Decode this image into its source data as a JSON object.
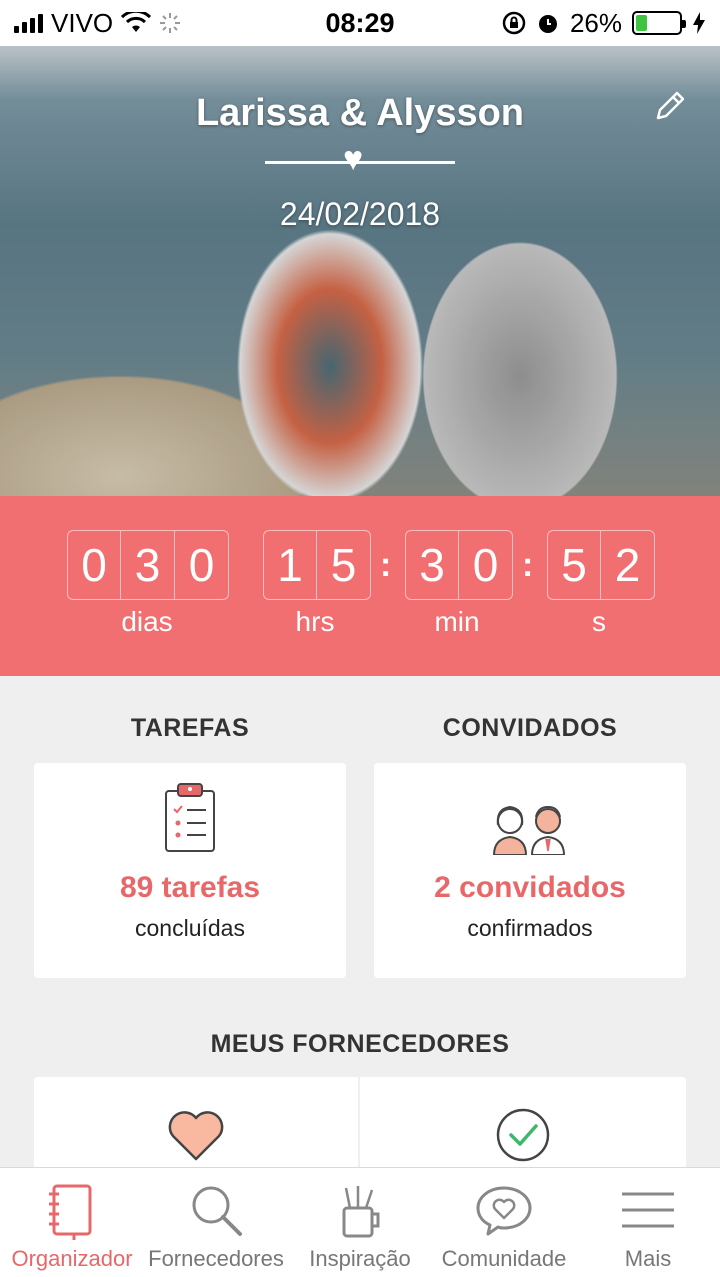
{
  "status_bar": {
    "carrier": "VIVO",
    "time": "08:29",
    "battery": "26%",
    "battery_level": 0.26
  },
  "hero": {
    "names": "Larissa & Alysson",
    "date": "24/02/2018"
  },
  "countdown": {
    "days": [
      "0",
      "3",
      "0"
    ],
    "hours": [
      "1",
      "5"
    ],
    "minutes": [
      "3",
      "0"
    ],
    "seconds": [
      "5",
      "2"
    ],
    "labels": {
      "days": "dias",
      "hours": "hrs",
      "minutes": "min",
      "seconds": "s"
    }
  },
  "tasks": {
    "title": "TAREFAS",
    "count": "89 tarefas",
    "sub": "concluídas"
  },
  "guests": {
    "title": "CONVIDADOS",
    "count": "2 convidados",
    "sub": "confirmados"
  },
  "vendors": {
    "title": "MEUS FORNECEDORES"
  },
  "tabbar": {
    "items": [
      {
        "label": "Organizador",
        "icon": "notebook-icon",
        "active": true
      },
      {
        "label": "Fornecedores",
        "icon": "search-icon"
      },
      {
        "label": "Inspiração",
        "icon": "pencil-cup-icon"
      },
      {
        "label": "Comunidade",
        "icon": "chat-heart-icon"
      },
      {
        "label": "Mais",
        "icon": "menu-icon"
      }
    ]
  },
  "colors": {
    "accent": "#f26f71",
    "accent_text": "#e86769"
  }
}
